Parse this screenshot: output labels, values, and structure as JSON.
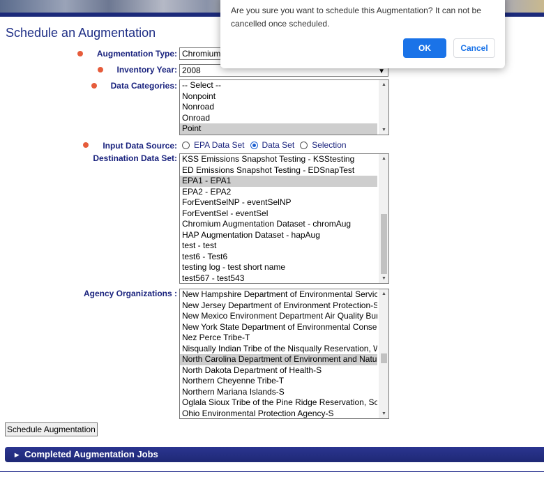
{
  "page": {
    "title": "Schedule an Augmentation"
  },
  "form": {
    "augmentation_type": {
      "label": "Augmentation Type:",
      "value": "Chromium"
    },
    "inventory_year": {
      "label": "Inventory Year:",
      "value": "2008"
    },
    "data_categories": {
      "label": "Data Categories:",
      "options": [
        "-- Select --",
        "Nonpoint",
        "Nonroad",
        "Onroad",
        "Point"
      ],
      "selected": "Point"
    },
    "input_data_source": {
      "label": "Input Data Source:",
      "options": [
        "EPA Data Set",
        "Data Set",
        "Selection"
      ],
      "selected": "Data Set"
    },
    "destination_data_set": {
      "label": "Destination Data Set:",
      "options": [
        "KSS Emissions Snapshot Testing - KSStesting",
        "ED Emissions Snapshot Testing - EDSnapTest",
        "EPA1 - EPA1",
        "EPA2 - EPA2",
        "ForEventSelNP - eventSelNP",
        "ForEventSel - eventSel",
        "Chromium Augmentation Dataset - chromAug",
        "HAP Augmentation Dataset - hapAug",
        "test - test",
        "test6 - Test6",
        "testing log - test short name",
        "test567 - test543"
      ],
      "selected": "EPA1 - EPA1"
    },
    "agency_organizations": {
      "label": "Agency Organizations :",
      "options": [
        "New Hampshire Department of Environmental Services",
        "New Jersey Department of Environment Protection-S",
        "New Mexico Environment Department Air Quality Bureau",
        "New York State Department of Environmental Conservation",
        "Nez Perce Tribe-T",
        "Nisqually Indian Tribe of the Nisqually Reservation, W",
        "North Carolina Department of Environment and Natural",
        "North Dakota Department of Health-S",
        "Northern Cheyenne Tribe-T",
        "Northern Mariana Islands-S",
        "Oglala Sioux Tribe of the Pine Ridge Reservation, So",
        "Ohio Environmental Protection Agency-S"
      ],
      "selected": "North Carolina Department of Environment and Natural"
    },
    "submit_label": "Schedule Augmentation"
  },
  "completed_jobs": {
    "label": "Completed Augmentation Jobs"
  },
  "dialog": {
    "message": "Are you sure you want to schedule this Augmentation? It can not be cancelled once scheduled.",
    "ok_label": "OK",
    "cancel_label": "Cancel"
  },
  "colors": {
    "accent": "#1a73e8",
    "header_bar": "#1e2875",
    "label_text": "#1a237e",
    "required_marker": "#e65c3b"
  },
  "icons": {
    "required": "asterisk-icon",
    "dropdown": "chevron-down-icon",
    "section_toggle": "caret-right-icon"
  }
}
